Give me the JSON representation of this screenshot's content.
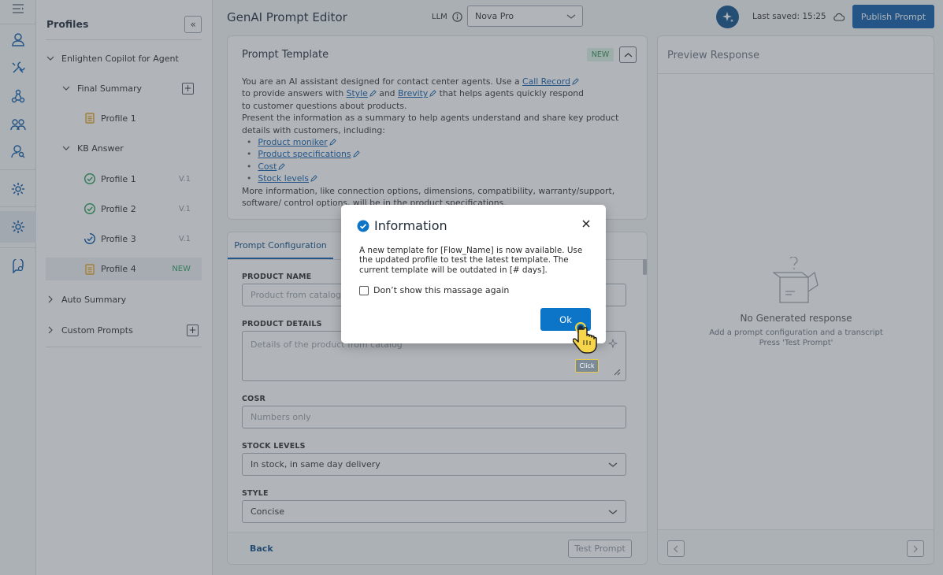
{
  "app": {
    "title": "GenAI Prompt Editor",
    "llm_label": "LLM",
    "llm_value": "Nova Pro",
    "last_saved": "Last saved: 15:25",
    "publish_label": "Publish Prompt"
  },
  "profiles": {
    "title": "Profiles",
    "collapse_icon": "«",
    "tree": [
      {
        "label": "Enlighten Copilot for Agent"
      },
      {
        "label": "Final Summary",
        "action": "+"
      },
      {
        "label": "Profile 1"
      },
      {
        "label": "KB Answer"
      },
      {
        "label": "Profile 1",
        "version": "V.1"
      },
      {
        "label": "Profile 2",
        "version": "V.1"
      },
      {
        "label": "Profile 3",
        "version": "V.1"
      },
      {
        "label": "Profile 4",
        "badge": "NEW"
      },
      {
        "label": "Auto Summary"
      },
      {
        "label": "Custom Prompts",
        "action": "+"
      }
    ]
  },
  "template": {
    "title": "Prompt Template",
    "badge": "NEW",
    "line1_a": "You are an AI assistant designed for contact center agents. Use a ",
    "link_call_record": "Call Record",
    "line2_a": "to provide answers with ",
    "link_style": "Style",
    "line2_b": " and ",
    "link_brevity": "Brevity",
    "line2_c": " that helps agents quickly respond",
    "line3": "to customer questions about products.",
    "line4": "Present the information as a summary to help agents understand and share key product details with customers, including:",
    "bullets": [
      "Product moniker",
      "Product specifications",
      "Cost",
      "Stock levels"
    ],
    "line5": "More information, like connection options, dimensions, compatibility, warranty/support, software/ control options, will be in the product specifications."
  },
  "config": {
    "tab": "Prompt Configuration",
    "product_name_label": "PRODUCT NAME",
    "product_name_placeholder": "Product from catalog",
    "product_details_label": "PRODUCT DETAILS",
    "product_details_placeholder": "Details of the product from catalog",
    "cost_label": "COSR",
    "cost_placeholder": "Numbers only",
    "stock_label": "STOCK LEVELS",
    "stock_value": "In stock, in same day delivery",
    "style_label": "STYLE",
    "style_value": "Concise",
    "back_label": "Back",
    "test_label": "Test Prompt"
  },
  "preview": {
    "title": "Preview Response",
    "empty_title": "No Generated response",
    "empty_line1": "Add a prompt configuration and a transcript",
    "empty_line2": "Press 'Test Prompt'"
  },
  "modal": {
    "title": "Information",
    "body": "A new template for [Flow_Name] is now available. Use the updated profile to test the latest template. The current template will be outdated in [# days].",
    "checkbox_label": "Don’t show this massage again",
    "ok_label": "Ok",
    "click_tag": "Click"
  },
  "colors": {
    "primary": "#0d5aa7",
    "ok": "#0d75c7",
    "success": "#2e9e5b",
    "profile_doc": "#e0a030"
  }
}
